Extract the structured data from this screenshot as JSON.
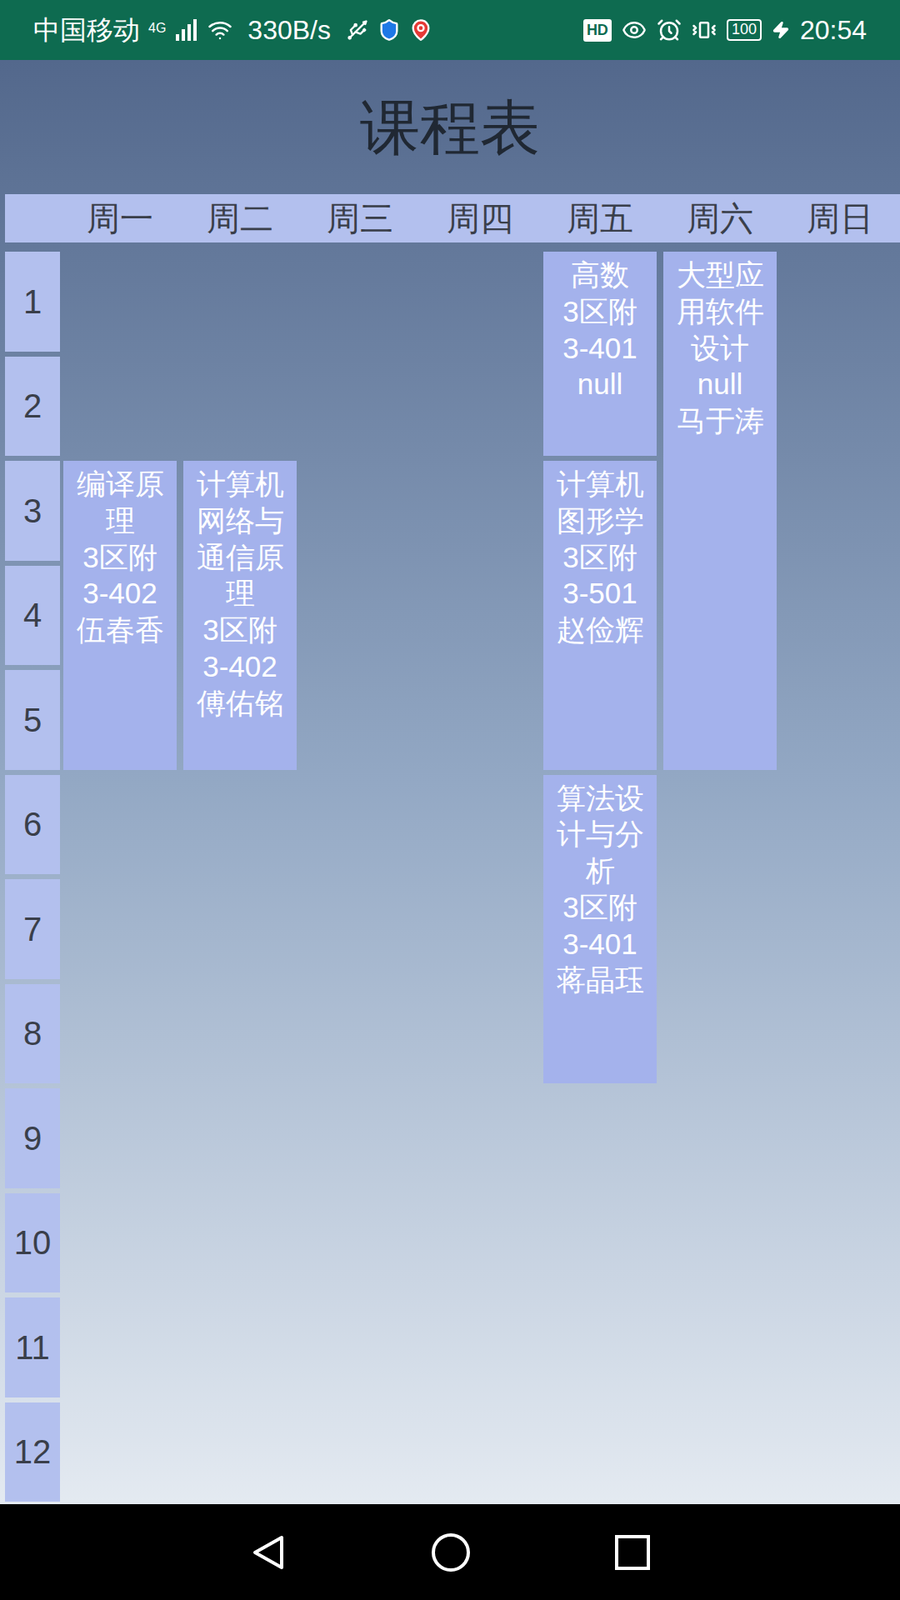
{
  "status_bar": {
    "carrier": "中国移动",
    "network": "4G",
    "speed": "330B/s",
    "hd": "HD",
    "battery": "100",
    "time": "20:54"
  },
  "title": "课程表",
  "days": [
    "周一",
    "周二",
    "周三",
    "周四",
    "周五",
    "周六",
    "周日"
  ],
  "periods": [
    "1",
    "2",
    "3",
    "4",
    "5",
    "6",
    "7",
    "8",
    "9",
    "10",
    "11",
    "12"
  ],
  "courses": [
    {
      "day": 1,
      "start": 3,
      "end": 5,
      "name": "编译原理",
      "building": "3区附",
      "room": "3-402",
      "teacher": "伍春香"
    },
    {
      "day": 2,
      "start": 3,
      "end": 5,
      "name": "计算机网络与通信原理",
      "building": "3区附",
      "room": "3-402",
      "teacher": "傅佑铭"
    },
    {
      "day": 5,
      "start": 1,
      "end": 2,
      "name": "高数",
      "building": "3区附",
      "room": "3-401",
      "teacher": "null"
    },
    {
      "day": 5,
      "start": 3,
      "end": 5,
      "name": "计算机图形学",
      "building": "3区附",
      "room": "3-501",
      "teacher": "赵俭辉"
    },
    {
      "day": 5,
      "start": 6,
      "end": 8,
      "name": "算法设计与分析",
      "building": "3区附",
      "room": "3-401",
      "teacher": "蒋晶珏"
    },
    {
      "day": 6,
      "start": 1,
      "end": 5,
      "name": "大型应用软件设计",
      "building": "",
      "room": "null",
      "teacher": "马于涛"
    }
  ]
}
